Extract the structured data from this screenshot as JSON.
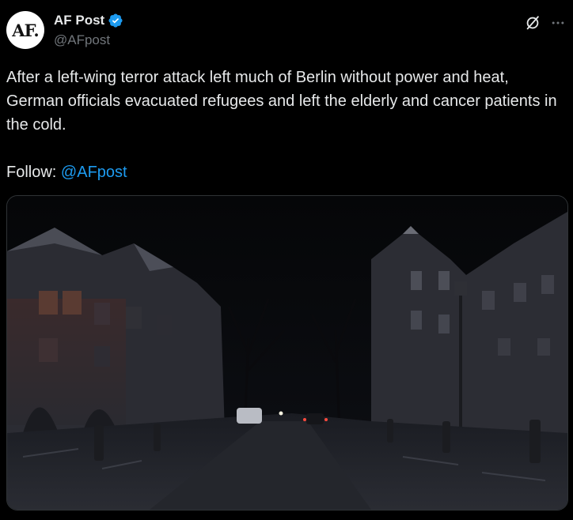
{
  "author": {
    "avatar_text": "AF.",
    "display_name": "AF Post",
    "handle": "@AFpost",
    "verified_color": "#1d9bf0"
  },
  "post": {
    "text": "After a left-wing terror attack left much of Berlin without power and heat, German officials evacuated refugees and left the elderly and cancer patients in the cold.",
    "follow_label": "Follow:",
    "mention": "@AFpost"
  },
  "icons": {
    "grok": "grok-icon",
    "more": "more-icon",
    "verified": "verified-badge-icon"
  },
  "colors": {
    "background": "#000000",
    "text": "#e7e9ea",
    "secondary_text": "#71767b",
    "link": "#1d9bf0"
  }
}
